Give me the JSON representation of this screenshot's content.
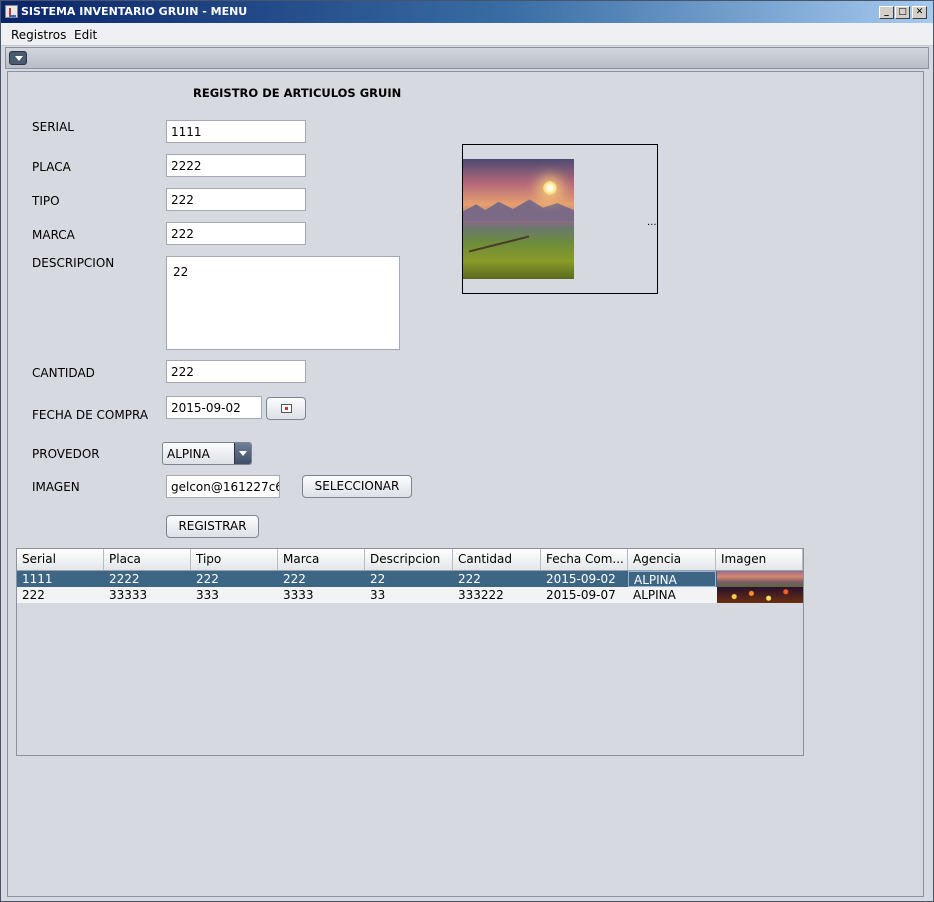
{
  "window": {
    "title": "SISTEMA INVENTARIO GRUIN - MENU",
    "controls": {
      "minimize": "_",
      "maximize": "□",
      "close": "✕"
    }
  },
  "menubar": {
    "items": [
      "Registros",
      "Edit"
    ]
  },
  "form": {
    "heading": "REGISTRO DE ARTICULOS GRUIN",
    "serial_label": "SERIAL",
    "serial_value": "1111",
    "placa_label": "PLACA",
    "placa_value": "2222",
    "tipo_label": "TIPO",
    "tipo_value": "222",
    "marca_label": "MARCA",
    "marca_value": "222",
    "descripcion_label": "DESCRIPCION",
    "descripcion_value": "22",
    "cantidad_label": "CANTIDAD",
    "cantidad_value": "222",
    "fecha_label": "FECHA DE COMPRA",
    "fecha_value": "2015-09-02",
    "provedor_label": "PROVEDOR",
    "provedor_value": "ALPINA",
    "imagen_label": "IMAGEN",
    "imagen_value": "gelcon@161227c6",
    "seleccionar_label": "SELECCIONAR",
    "registrar_label": "REGISTRAR",
    "preview_dots": "..."
  },
  "table": {
    "columns": [
      "Serial",
      "Placa",
      "Tipo",
      "Marca",
      "Descripcion",
      "Cantidad",
      "Fecha Com...",
      "Agencia",
      "Imagen"
    ],
    "rows": [
      [
        "1111",
        "2222",
        "222",
        "222",
        "22",
        "222",
        "2015-09-02",
        "ALPINA"
      ],
      [
        "222",
        "33333",
        "333",
        "3333",
        "33",
        "333222",
        "2015-09-07",
        "ALPINA"
      ]
    ]
  },
  "colors": {
    "selected_row": "#3d6685",
    "title_bar": "#0a246a"
  }
}
